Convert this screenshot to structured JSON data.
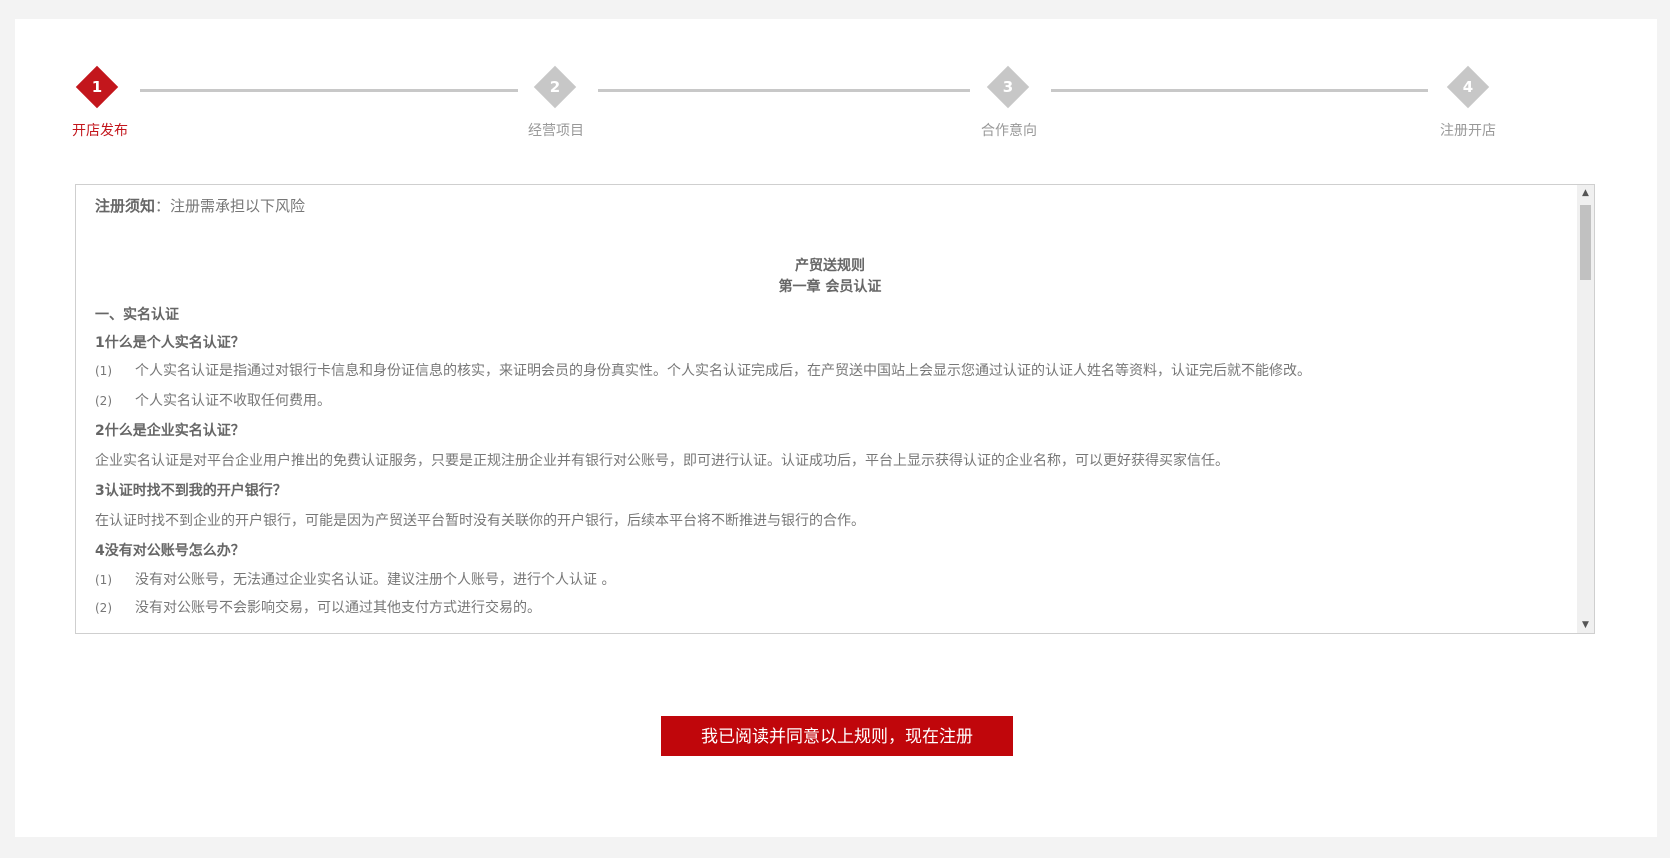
{
  "steps": [
    {
      "num": "1",
      "label": "开店发布",
      "active": true
    },
    {
      "num": "2",
      "label": "经营项目",
      "active": false
    },
    {
      "num": "3",
      "label": "合作意向",
      "active": false
    },
    {
      "num": "4",
      "label": "注册开店",
      "active": false
    }
  ],
  "terms": {
    "notice_bold": "注册须知",
    "notice_text": "：注册需承担以下风险",
    "title": "产贸送规则",
    "chapter": "第一章   会员认证",
    "lines": [
      {
        "text": "一、实名认证",
        "bold": true
      },
      {
        "text": "1什么是个人实名认证？",
        "bold": true
      },
      {
        "idx": "(1)",
        "text": "个人实名认证是指通过对银行卡信息和身份证信息的核实，来证明会员的身份真实性。个人实名认证完成后，在产贸送中国站上会显示您通过认证的认证人姓名等资料，认证完后就不能修改。"
      },
      {
        "idx": "(2)",
        "text": "个人实名认证不收取任何费用。"
      },
      {
        "text": "2什么是企业实名认证？",
        "bold": true
      },
      {
        "text": "企业实名认证是对平台企业用户推出的免费认证服务，只要是正规注册企业并有银行对公账号，即可进行认证。认证成功后，平台上显示获得认证的企业名称，可以更好获得买家信任。"
      },
      {
        "text": "3认证时找不到我的开户银行？",
        "bold": true
      },
      {
        "text": "在认证时找不到企业的开户银行，可能是因为产贸送平台暂时没有关联你的开户银行，后续本平台将不断推进与银行的合作。"
      },
      {
        "text": "4没有对公账号怎么办？",
        "bold": true
      },
      {
        "idx": "(1)",
        "text": "没有对公账号，无法通过企业实名认证。建议注册个人账号，进行个人认证 。"
      },
      {
        "idx": "(2)",
        "text": "没有对公账号不会影响交易，可以通过其他支付方式进行交易的。"
      }
    ]
  },
  "agree_button": "我已阅读并同意以上规则，现在注册",
  "colors": {
    "accent": "#c3161c",
    "inactive": "#c7c7c7"
  },
  "icons": {
    "scroll_up": "triangle-up",
    "scroll_down": "triangle-down"
  }
}
